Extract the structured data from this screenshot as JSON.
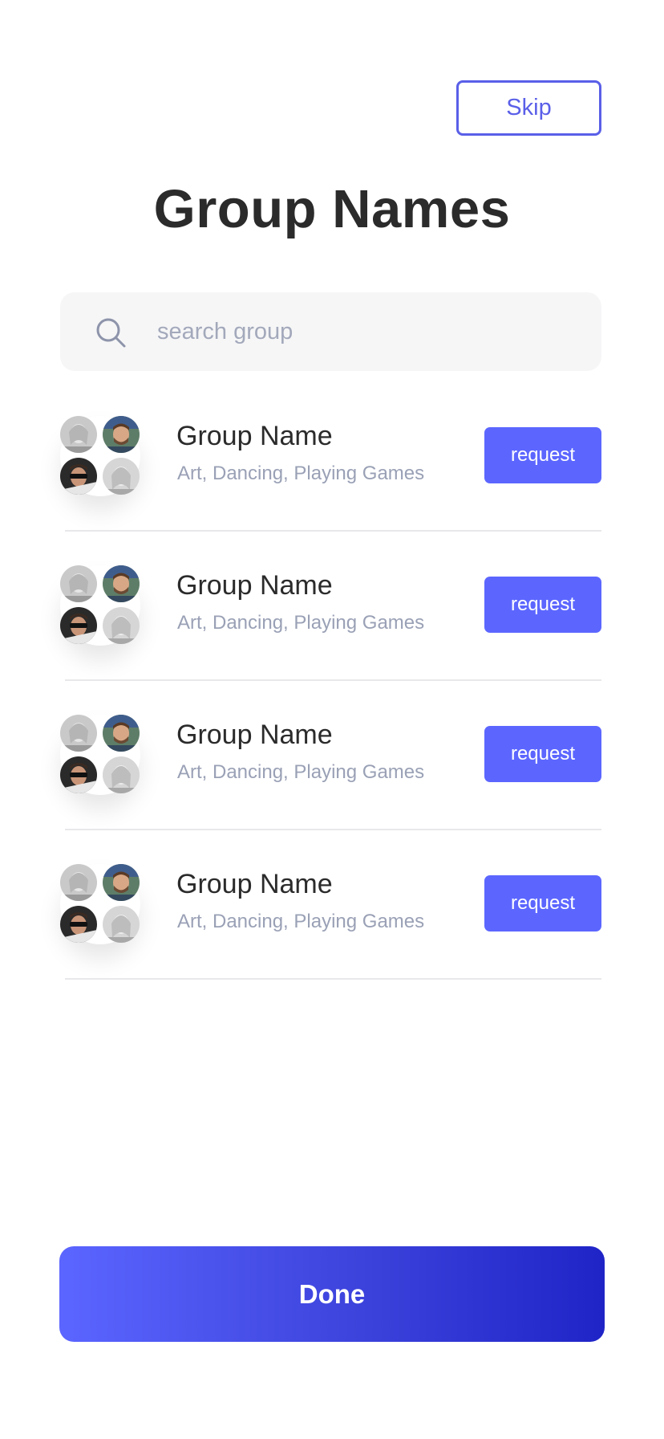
{
  "header": {
    "skip_label": "Skip",
    "title": "Group Names"
  },
  "search": {
    "placeholder": "search group",
    "value": "",
    "icon": "search-icon"
  },
  "groups": [
    {
      "name": "Group Name",
      "tags": "Art, Dancing, Playing Games",
      "action_label": "request"
    },
    {
      "name": "Group Name",
      "tags": "Art, Dancing, Playing Games",
      "action_label": "request"
    },
    {
      "name": "Group Name",
      "tags": "Art, Dancing, Playing Games",
      "action_label": "request"
    },
    {
      "name": "Group Name",
      "tags": "Art, Dancing, Playing Games",
      "action_label": "request"
    }
  ],
  "footer": {
    "done_label": "Done"
  },
  "colors": {
    "accent": "#5a5fe8",
    "request_button": "#5c66ff",
    "done_gradient_start": "#5b65ff",
    "done_gradient_end": "#1f24c7",
    "title_text": "#2b2b2b",
    "muted_text": "#9aa1b6"
  }
}
